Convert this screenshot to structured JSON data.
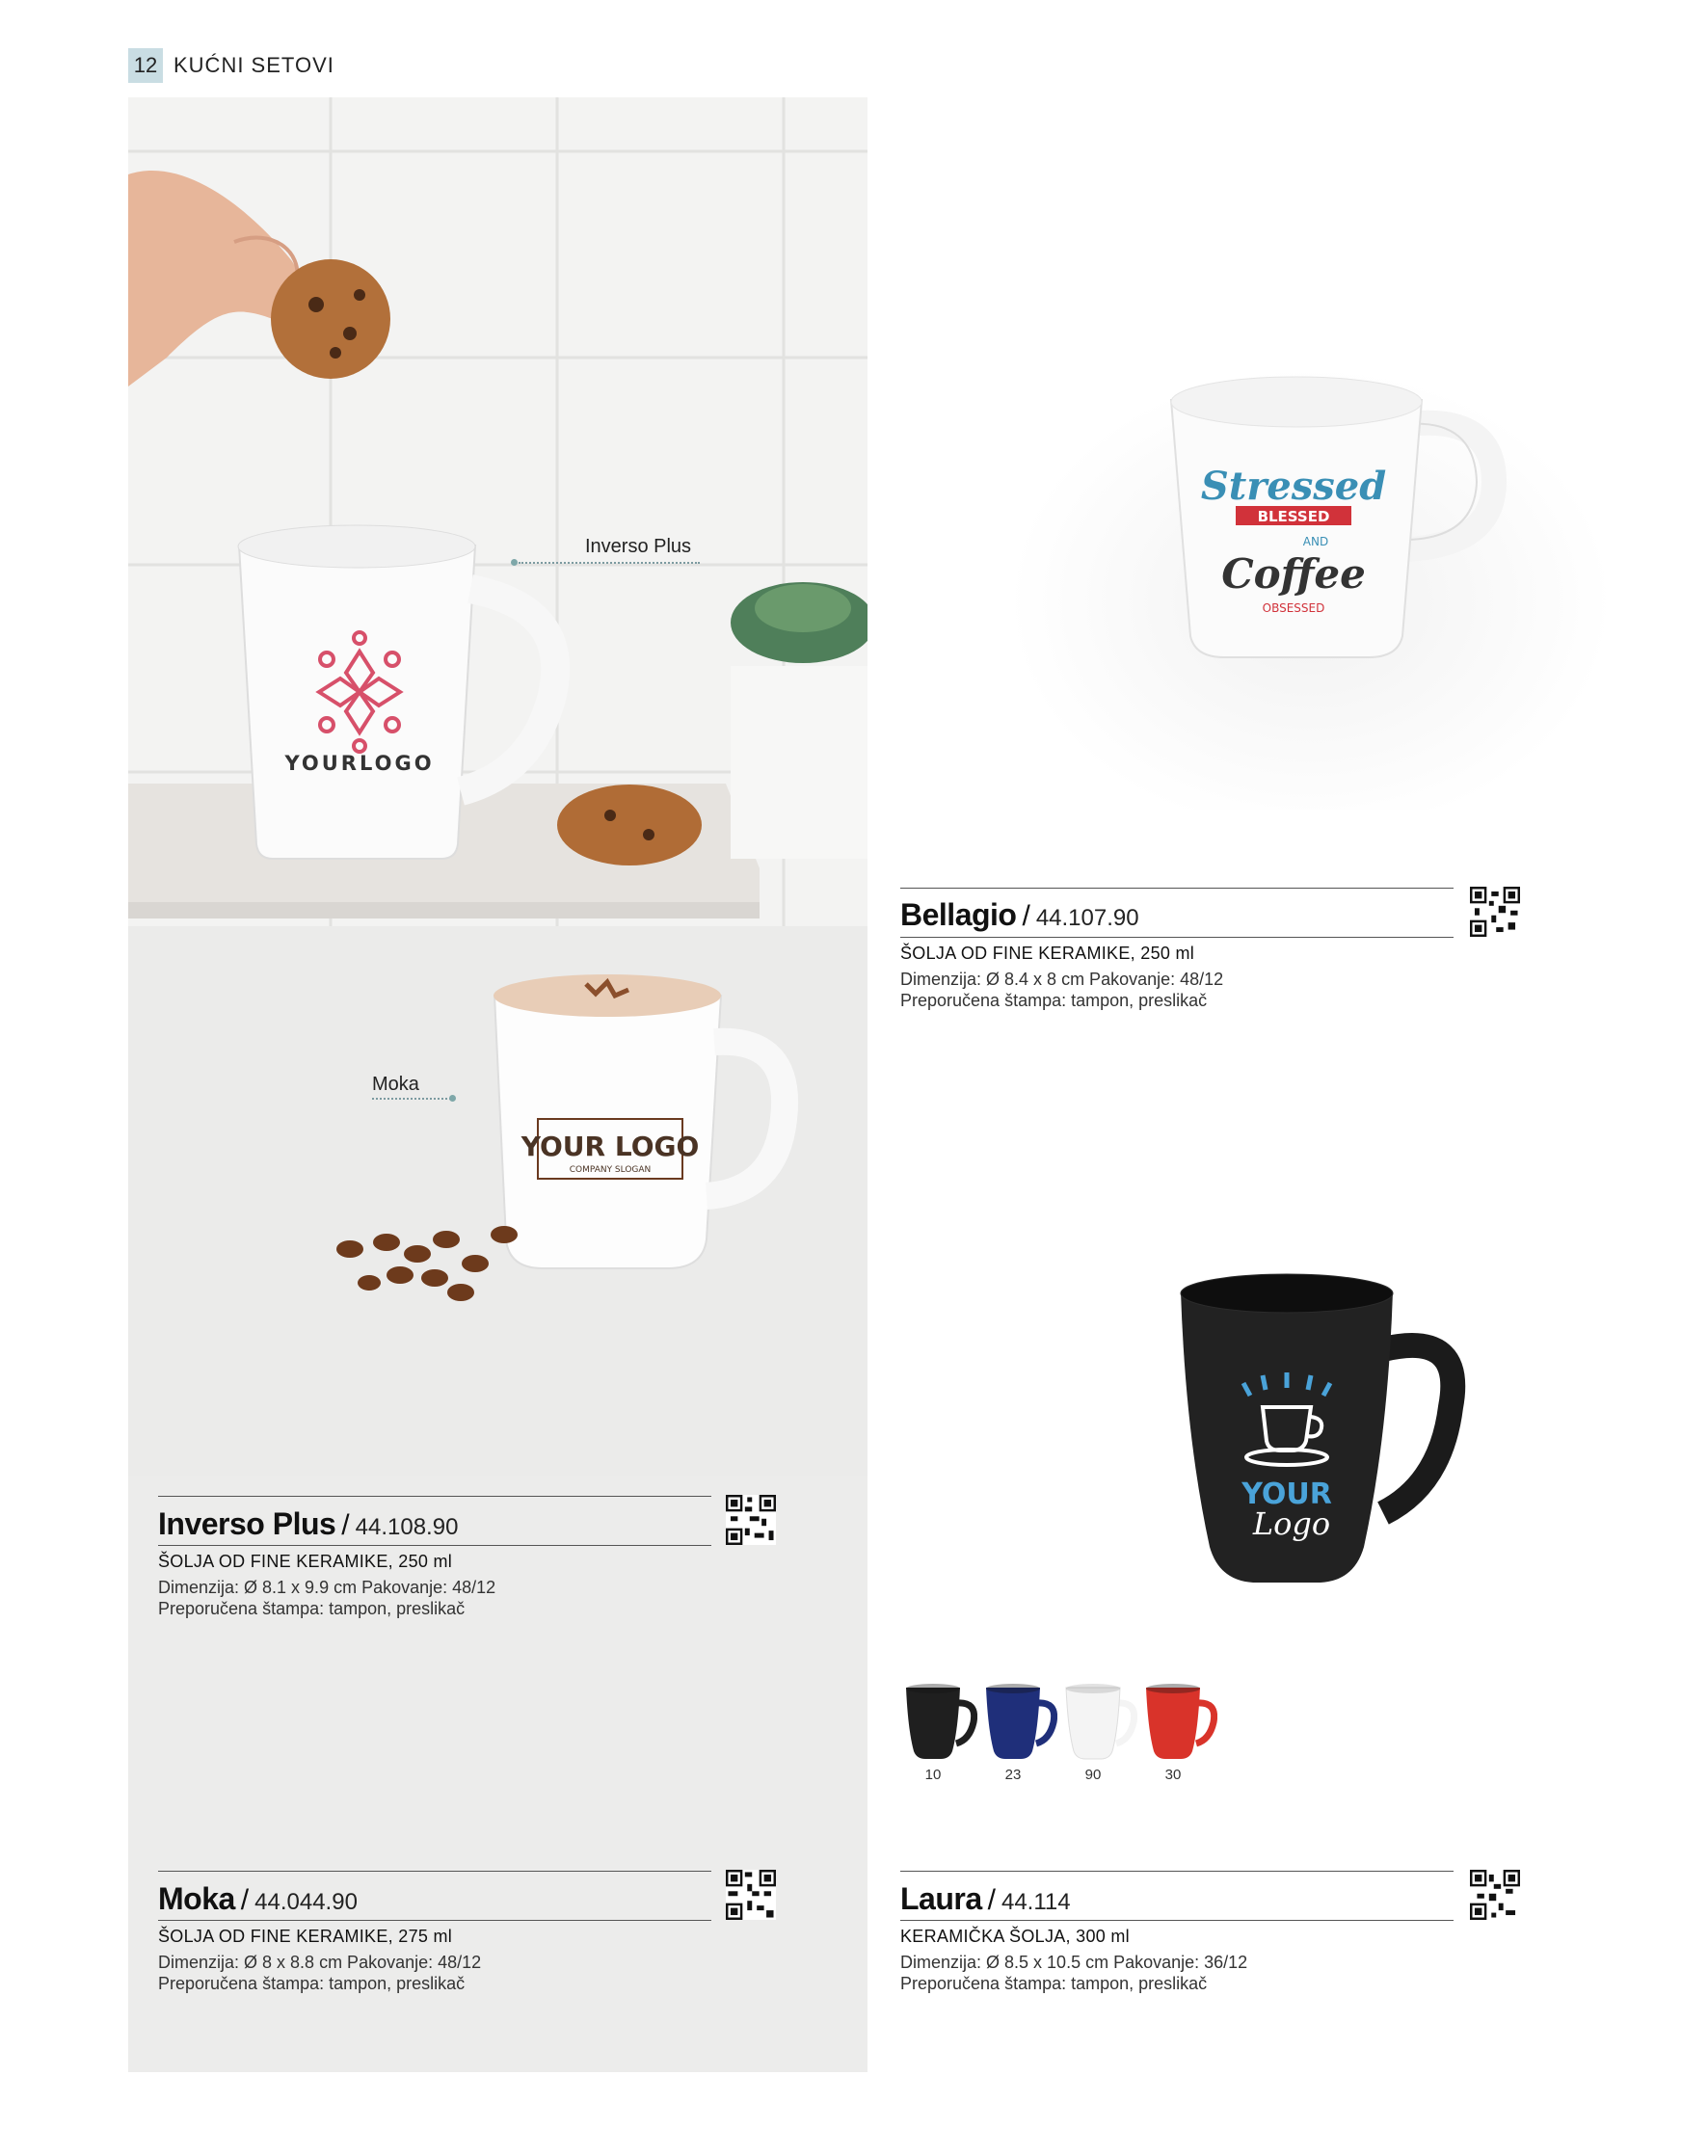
{
  "header": {
    "page_number": "12",
    "section": "KUĆNI SETOVI"
  },
  "callouts": {
    "inverso": "Inverso Plus",
    "moka": "Moka"
  },
  "mug_prints": {
    "inverso_logo": "YOURLOGO",
    "moka_logo": "YOUR LOGO",
    "moka_slogan": "COMPANY SLOGAN",
    "bellagio_l1": "Stressed",
    "bellagio_l2": "BLESSED",
    "bellagio_l3": "AND",
    "bellagio_l4": "Coffee",
    "bellagio_l5": "OBSESSED",
    "laura_l1": "YOUR",
    "laura_l2": "Logo"
  },
  "products": {
    "inverso": {
      "name": "Inverso Plus",
      "separator": "/",
      "code": "44.108.90",
      "type": "ŠOLJA OD FINE KERAMIKE, 250 ml",
      "dims": "Dimenzija: Ø 8.1 x 9.9 cm Pakovanje: 48/12",
      "print": "Preporučena štampa: tampon, preslikač"
    },
    "moka": {
      "name": "Moka",
      "separator": "/",
      "code": "44.044.90",
      "type": "ŠOLJA OD FINE KERAMIKE, 275 ml",
      "dims": "Dimenzija: Ø 8 x 8.8 cm Pakovanje: 48/12",
      "print": "Preporučena štampa: tampon, preslikač"
    },
    "bellagio": {
      "name": "Bellagio",
      "separator": "/",
      "code": "44.107.90",
      "type": "ŠOLJA OD FINE KERAMIKE, 250 ml",
      "dims": "Dimenzija: Ø 8.4 x 8 cm Pakovanje: 48/12",
      "print": "Preporučena štampa: tampon, preslikač"
    },
    "laura": {
      "name": "Laura",
      "separator": "/",
      "code": "44.114",
      "type": "KERAMIČKA ŠOLJA, 300 ml",
      "dims": "Dimenzija: Ø 8.5 x 10.5 cm Pakovanje: 36/12",
      "print": "Preporučena štampa: tampon, preslikač"
    }
  },
  "laura_colors": [
    {
      "code": "10",
      "color": "#1f1f1f"
    },
    {
      "code": "23",
      "color": "#1f2f7a"
    },
    {
      "code": "90",
      "color": "#f4f4f4"
    },
    {
      "code": "30",
      "color": "#d9332a"
    }
  ],
  "colors": {
    "accent_tab": "#c9dde3",
    "panel": "#ececeb",
    "callout_dot": "#7ea7a9"
  }
}
